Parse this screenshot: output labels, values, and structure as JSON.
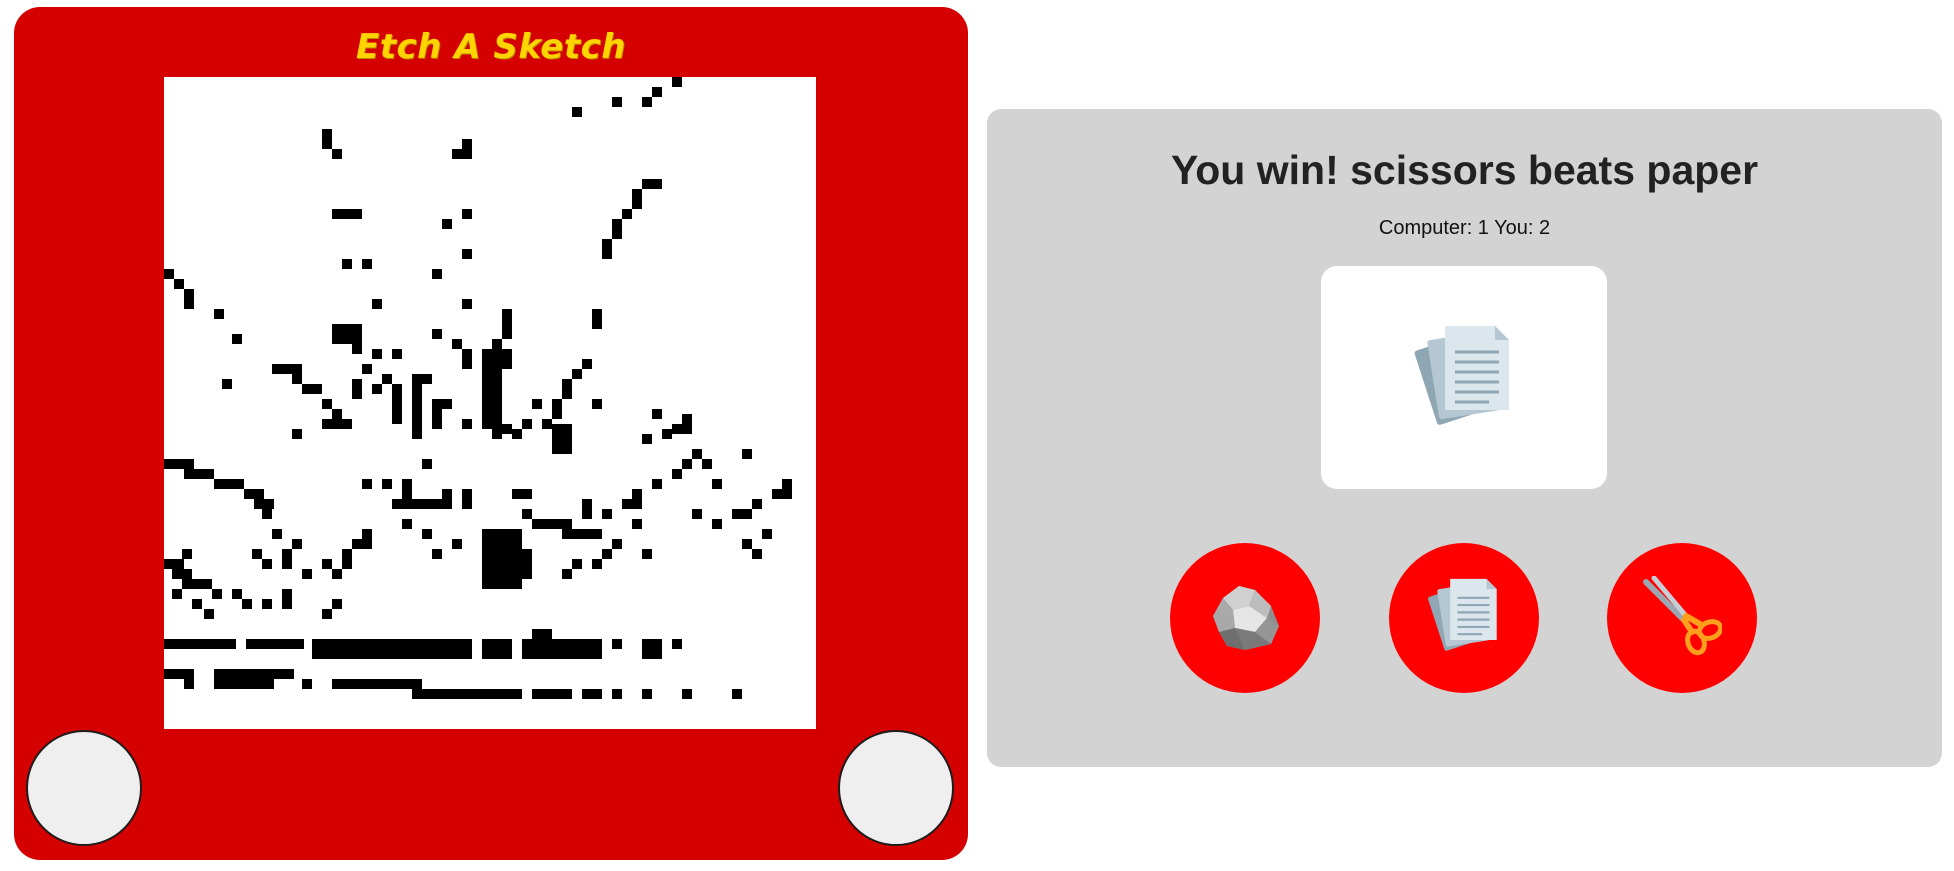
{
  "etch_a_sketch": {
    "logo_text": "Etch A Sketch"
  },
  "game": {
    "result_message": "You win! scissors beats paper",
    "score_text": "Computer: 1 You: 2",
    "computer_choice_icon": "paper-icon",
    "choices": [
      {
        "icon": "rock-icon"
      },
      {
        "icon": "paper-icon"
      },
      {
        "icon": "scissors-icon"
      }
    ]
  },
  "colors": {
    "etch_frame": "#d50000",
    "logo": "#ffd400",
    "panel_bg": "#d3d3d3",
    "choice_button": "#ff0000"
  }
}
